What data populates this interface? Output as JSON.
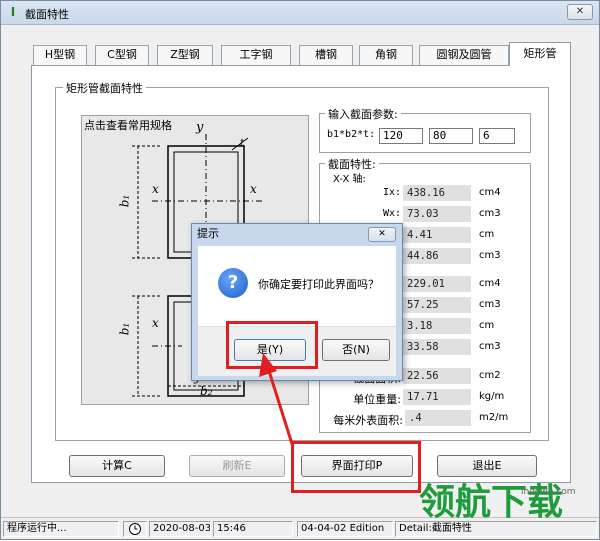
{
  "window": {
    "title": "截面特性",
    "close": "✕",
    "app_icon": "I"
  },
  "tabs": [
    "H型钢",
    "C型钢",
    "Z型钢",
    "工字钢",
    "槽钢",
    "角钢",
    "圆钢及圆管",
    "矩形管"
  ],
  "active_tab": "矩形管",
  "section_group_title": "矩形管截面特性",
  "drawing": {
    "caption": "点击查看常用规格",
    "labels": {
      "y_top": "y",
      "x_left": "x",
      "x_right": "x",
      "b1_upper": "b₁",
      "b1_lower": "b₁",
      "t": "t",
      "x_lower": "x",
      "y_bottom": "y",
      "b2": "b₂"
    }
  },
  "input_group": {
    "title": "输入截面参数:",
    "label": "b1*b2*t:",
    "values": [
      "120",
      "80",
      "6"
    ]
  },
  "props_group": {
    "title": "截面特性:",
    "axis_label": "X-X 轴:",
    "rows": [
      {
        "label": "Ix:",
        "value": "438.16",
        "unit": "cm4"
      },
      {
        "label": "Wx:",
        "value": "73.03",
        "unit": "cm3"
      },
      {
        "label": "",
        "value": "4.41",
        "unit": "cm"
      },
      {
        "label": "",
        "value": "44.86",
        "unit": "cm3"
      },
      {
        "label": "",
        "value": "229.01",
        "unit": "cm4"
      },
      {
        "label": "",
        "value": "57.25",
        "unit": "cm3"
      },
      {
        "label": "",
        "value": "3.18",
        "unit": "cm"
      },
      {
        "label": "",
        "value": "33.58",
        "unit": "cm3"
      },
      {
        "label": "截面面积:",
        "value": "22.56",
        "unit": "cm2"
      },
      {
        "label": "单位重量:",
        "value": "17.71",
        "unit": "kg/m"
      },
      {
        "label": "每米外表面积:",
        "value": ".4",
        "unit": "m2/m"
      }
    ]
  },
  "buttons": {
    "calc": "计算C",
    "refresh": "刷新E",
    "print": "界面打印P",
    "exit": "退出E"
  },
  "status": {
    "running": "程序运行中...",
    "date": "2020-08-03",
    "time": "15:46",
    "edition": "04-04-02 Edition",
    "detail": "Detail:截面特性"
  },
  "dialog": {
    "title": "提示",
    "close": "✕",
    "icon": "?",
    "message": "你确定要打印此界面吗？",
    "yes": "是(Y)",
    "no": "否(N)"
  },
  "watermark": {
    "text": "领航下载",
    "url": "lhdown.com"
  },
  "colors": {
    "annotation": "#e02020",
    "watermark": "#1e9b3a"
  }
}
